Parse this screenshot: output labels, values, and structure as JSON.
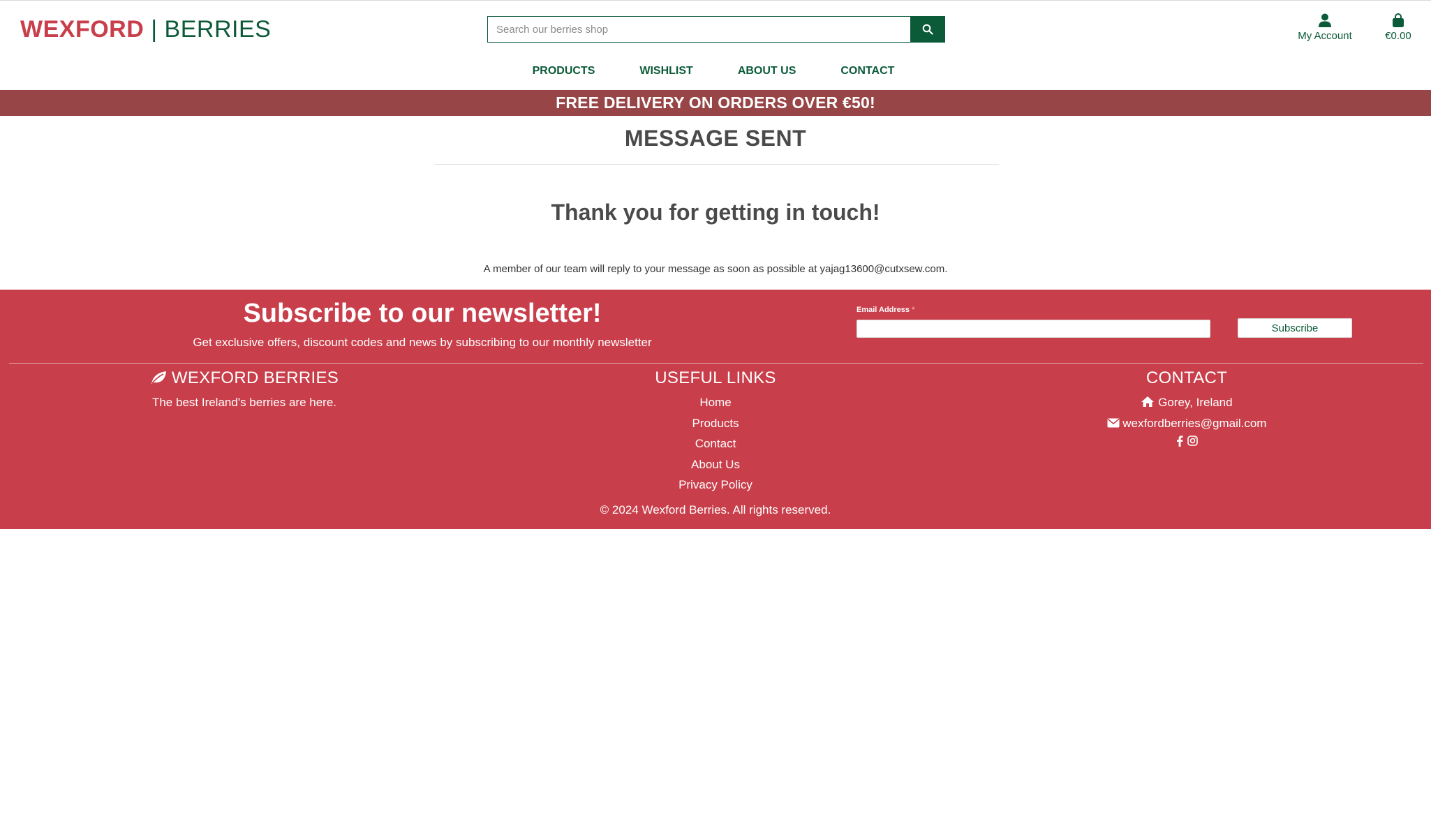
{
  "header": {
    "logo_part1": "WEXFORD",
    "logo_separator": "|",
    "logo_part2": "BERRIES",
    "search_placeholder": "Search our berries shop",
    "account_label": "My Account",
    "cart_total": "€0.00",
    "icons": {
      "search": "search-icon",
      "account": "user-icon",
      "cart": "shopping-bag-icon"
    }
  },
  "nav": {
    "items": [
      {
        "label": "PRODUCTS"
      },
      {
        "label": "WISHLIST"
      },
      {
        "label": "ABOUT US"
      },
      {
        "label": "CONTACT"
      }
    ]
  },
  "banner": {
    "text": "FREE DELIVERY ON ORDERS OVER €50!"
  },
  "main": {
    "title": "MESSAGE SENT",
    "thanks": "Thank you for getting in touch!",
    "reply": "A member of our team will reply to your message as soon as possible at yajag13600@cutxsew.com."
  },
  "newsletter": {
    "title": "Subscribe to our newsletter!",
    "subtitle": "Get exclusive offers, discount codes and news by subscribing to our monthly newsletter",
    "email_label": "Email Address",
    "required_mark": "*",
    "email_value": "",
    "button_label": "Subscribe"
  },
  "footer": {
    "brand_title": "WEXFORD BERRIES",
    "brand_tagline": "The best Ireland's berries are here.",
    "links_title": "USEFUL LINKS",
    "links": [
      "Home",
      "Products",
      "Contact",
      "About Us",
      "Privacy Policy"
    ],
    "contact_title": "CONTACT",
    "address": "Gorey, Ireland",
    "email": "wexfordberries@gmail.com",
    "copyright": "© 2024 Wexford Berries. All rights reserved."
  },
  "colors": {
    "brand_red": "#c83e4a",
    "brand_green": "#0b5a38",
    "banner": "#974546",
    "text": "#4a4a4a"
  }
}
